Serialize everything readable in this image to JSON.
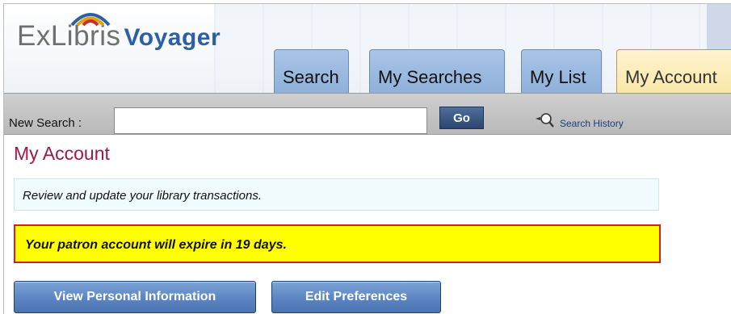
{
  "brand": {
    "logo_ex": "ExLibris",
    "logo_product": "Voyager",
    "arc_colors": [
      "#2c5fa6",
      "#e2a400",
      "#cc2c2c"
    ]
  },
  "tabs": [
    {
      "label": "Search"
    },
    {
      "label": "My Searches"
    },
    {
      "label": "My List"
    },
    {
      "label": "My Account"
    }
  ],
  "search": {
    "label": "New Search :",
    "value": "",
    "go_label": "Go",
    "history_label": "Search History",
    "history_icon": "magnifier-history-icon"
  },
  "page": {
    "title": "My Account",
    "description": "Review and update your library transactions.",
    "warning": "Your patron account will expire in 19 days.",
    "warning_bg": "#ffff00",
    "warning_border": "#d8201a",
    "title_color": "#9b1a49"
  },
  "actions": {
    "view_personal": "View Personal Information",
    "edit_preferences": "Edit Preferences"
  }
}
